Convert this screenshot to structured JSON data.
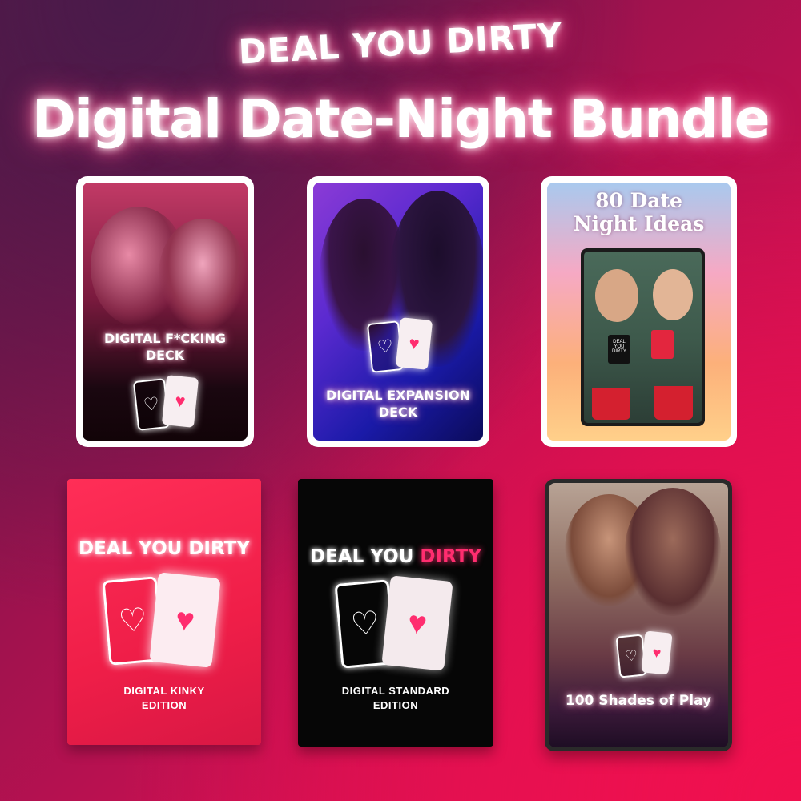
{
  "brand": "DEAL YOU DIRTY",
  "headline": "Digital Date-Night Bundle",
  "products": [
    {
      "title_line1": "DIGITAL F*CKING",
      "title_line2": "DECK",
      "heart_glyph": "♡",
      "heart_fill_glyph": "♥"
    },
    {
      "title_line1": "DIGITAL EXPANSION",
      "title_line2": "DECK",
      "heart_glyph": "♡",
      "heart_fill_glyph": "♥"
    },
    {
      "title_line1": "80 Date",
      "title_line2": "Night Ideas",
      "card_mini_text": "DEAL YOU DIRTY"
    },
    {
      "brand": "DEAL YOU DIRTY",
      "edition_line1": "DIGITAL KINKY",
      "edition_line2": "EDITION",
      "heart_glyph": "♡",
      "heart_fill_glyph": "♥"
    },
    {
      "brand_part1": "DEAL YOU ",
      "brand_part2": "DIRTY",
      "edition_line1": "DIGITAL STANDARD",
      "edition_line2": "EDITION",
      "heart_glyph": "♡",
      "heart_fill_glyph": "♥"
    },
    {
      "title": "100 Shades of Play",
      "heart_glyph": "♡",
      "heart_fill_glyph": "♥"
    }
  ],
  "colors": {
    "accent_pink": "#ff2d6f",
    "kinky_red": "#ee1f4a",
    "standard_black": "#060606"
  }
}
